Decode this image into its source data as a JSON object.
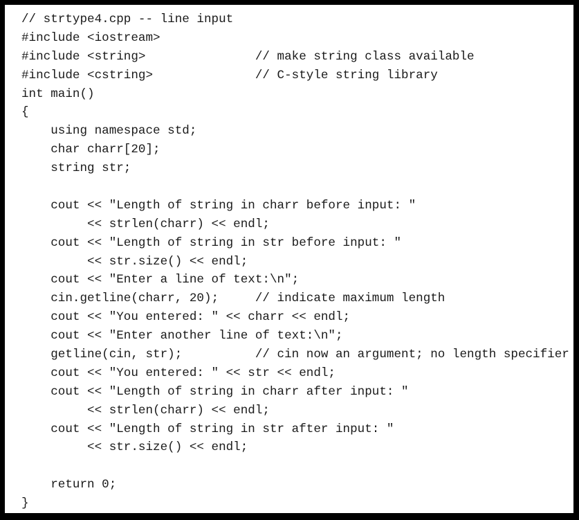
{
  "code": {
    "lines": [
      "// strtype4.cpp -- line input",
      "#include <iostream>",
      "#include <string>               // make string class available",
      "#include <cstring>              // C-style string library",
      "int main()",
      "{",
      "    using namespace std;",
      "    char charr[20];",
      "    string str;",
      "",
      "    cout << \"Length of string in charr before input: \"",
      "         << strlen(charr) << endl;",
      "    cout << \"Length of string in str before input: \"",
      "         << str.size() << endl;",
      "    cout << \"Enter a line of text:\\n\";",
      "    cin.getline(charr, 20);     // indicate maximum length",
      "    cout << \"You entered: \" << charr << endl;",
      "    cout << \"Enter another line of text:\\n\";",
      "    getline(cin, str);          // cin now an argument; no length specifier",
      "    cout << \"You entered: \" << str << endl;",
      "    cout << \"Length of string in charr after input: \"",
      "         << strlen(charr) << endl;",
      "    cout << \"Length of string in str after input: \"",
      "         << str.size() << endl;",
      "",
      "    return 0;",
      "}"
    ]
  }
}
